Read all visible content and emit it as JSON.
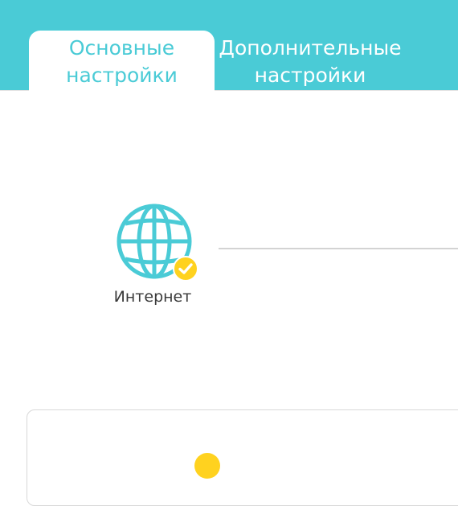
{
  "tabs": {
    "basic": {
      "line1": "Основные",
      "line2": "настройки"
    },
    "advanced": {
      "line1": "Дополнительные",
      "line2": "настройки"
    }
  },
  "network_map": {
    "internet": {
      "label": "Интернет",
      "icon": "globe-icon",
      "status_icon": "check-badge-icon"
    }
  },
  "colors": {
    "accent": "#4acbd6",
    "status_ok": "#ffd21f",
    "text": "#3a3a3a",
    "line": "#d3d3d3"
  }
}
